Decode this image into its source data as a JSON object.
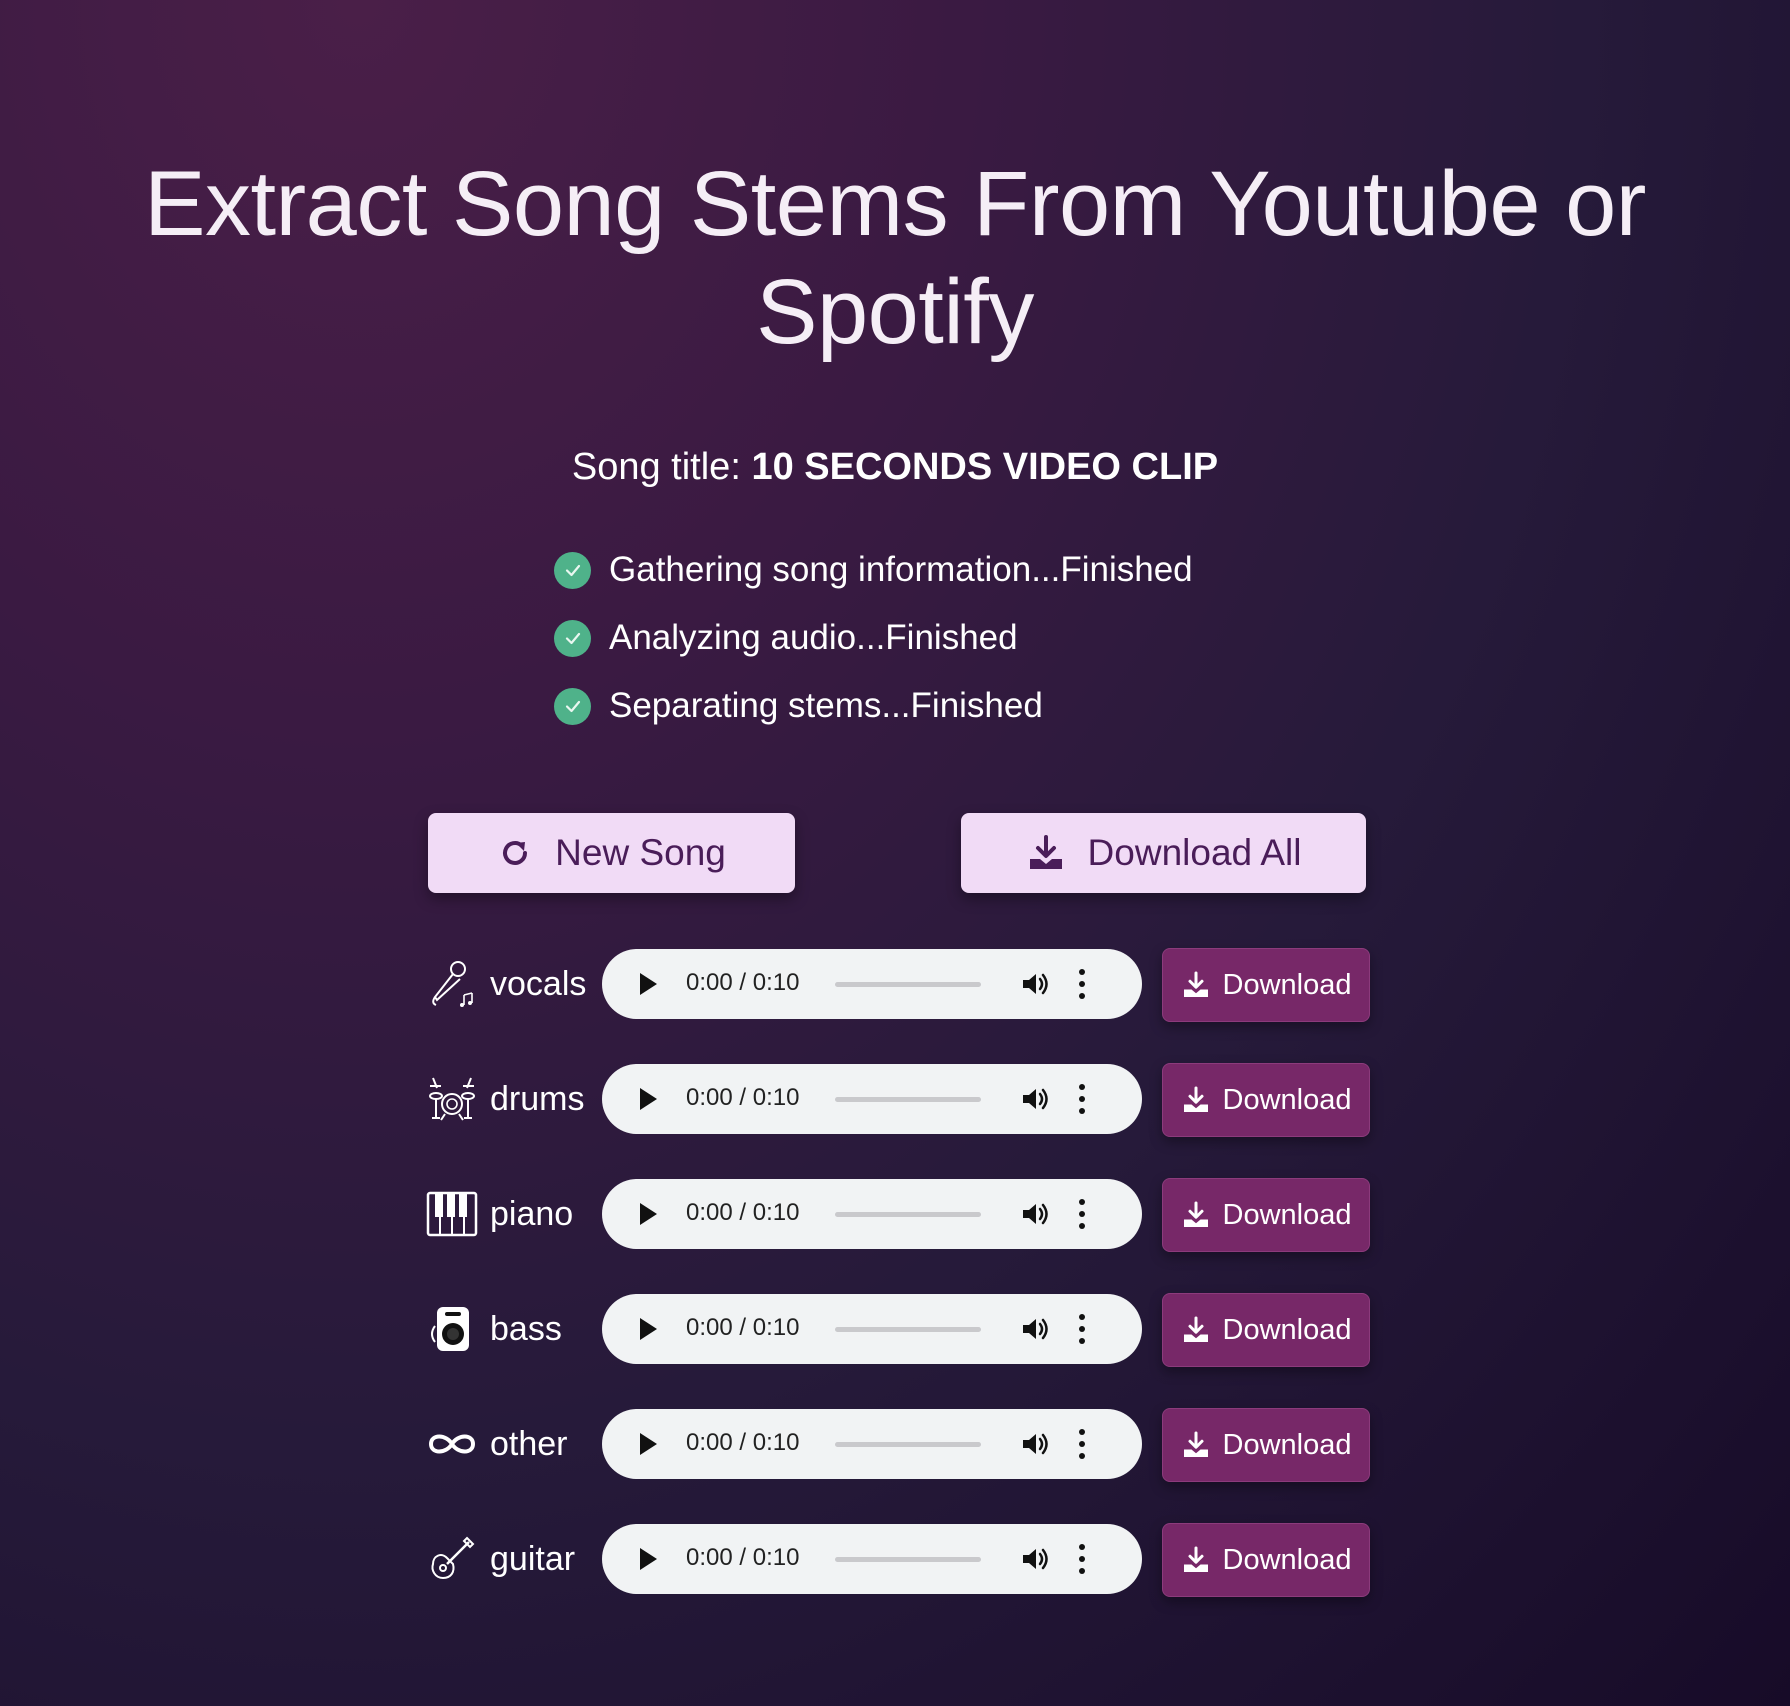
{
  "hero": {
    "title": "Extract Song Stems From Youtube or Spotify"
  },
  "song": {
    "label": "Song title:",
    "title": "10 SECONDS VIDEO CLIP"
  },
  "status": [
    {
      "text": "Gathering song information...Finished",
      "icon": "check-circle-icon"
    },
    {
      "text": "Analyzing audio...Finished",
      "icon": "check-circle-icon"
    },
    {
      "text": "Separating stems...Finished",
      "icon": "check-circle-icon"
    }
  ],
  "actions": {
    "new_song_label": "New Song",
    "new_song_icon": "refresh-icon",
    "download_all_label": "Download All",
    "download_all_icon": "download-icon"
  },
  "stems": [
    {
      "name": "vocals",
      "icon": "microphone-icon",
      "time": "0:00 / 0:10",
      "progress": 0,
      "download_label": "Download"
    },
    {
      "name": "drums",
      "icon": "drum-kit-icon",
      "time": "0:00 / 0:10",
      "progress": 0,
      "download_label": "Download"
    },
    {
      "name": "piano",
      "icon": "piano-icon",
      "time": "0:00 / 0:10",
      "progress": 0,
      "download_label": "Download"
    },
    {
      "name": "bass",
      "icon": "speaker-icon",
      "time": "0:00 / 0:10",
      "progress": 0,
      "download_label": "Download"
    },
    {
      "name": "other",
      "icon": "infinity-icon",
      "time": "0:00 / 0:10",
      "progress": 0,
      "download_label": "Download"
    },
    {
      "name": "guitar",
      "icon": "guitar-icon",
      "time": "0:00 / 0:10",
      "progress": 0,
      "download_label": "Download"
    }
  ],
  "colors": {
    "check": "#4fb28a",
    "primary_button_bg": "#f1dbf6",
    "primary_button_text": "#4a1d59",
    "download_button_bg": "#772868",
    "player_bg": "#f1f3f4"
  }
}
